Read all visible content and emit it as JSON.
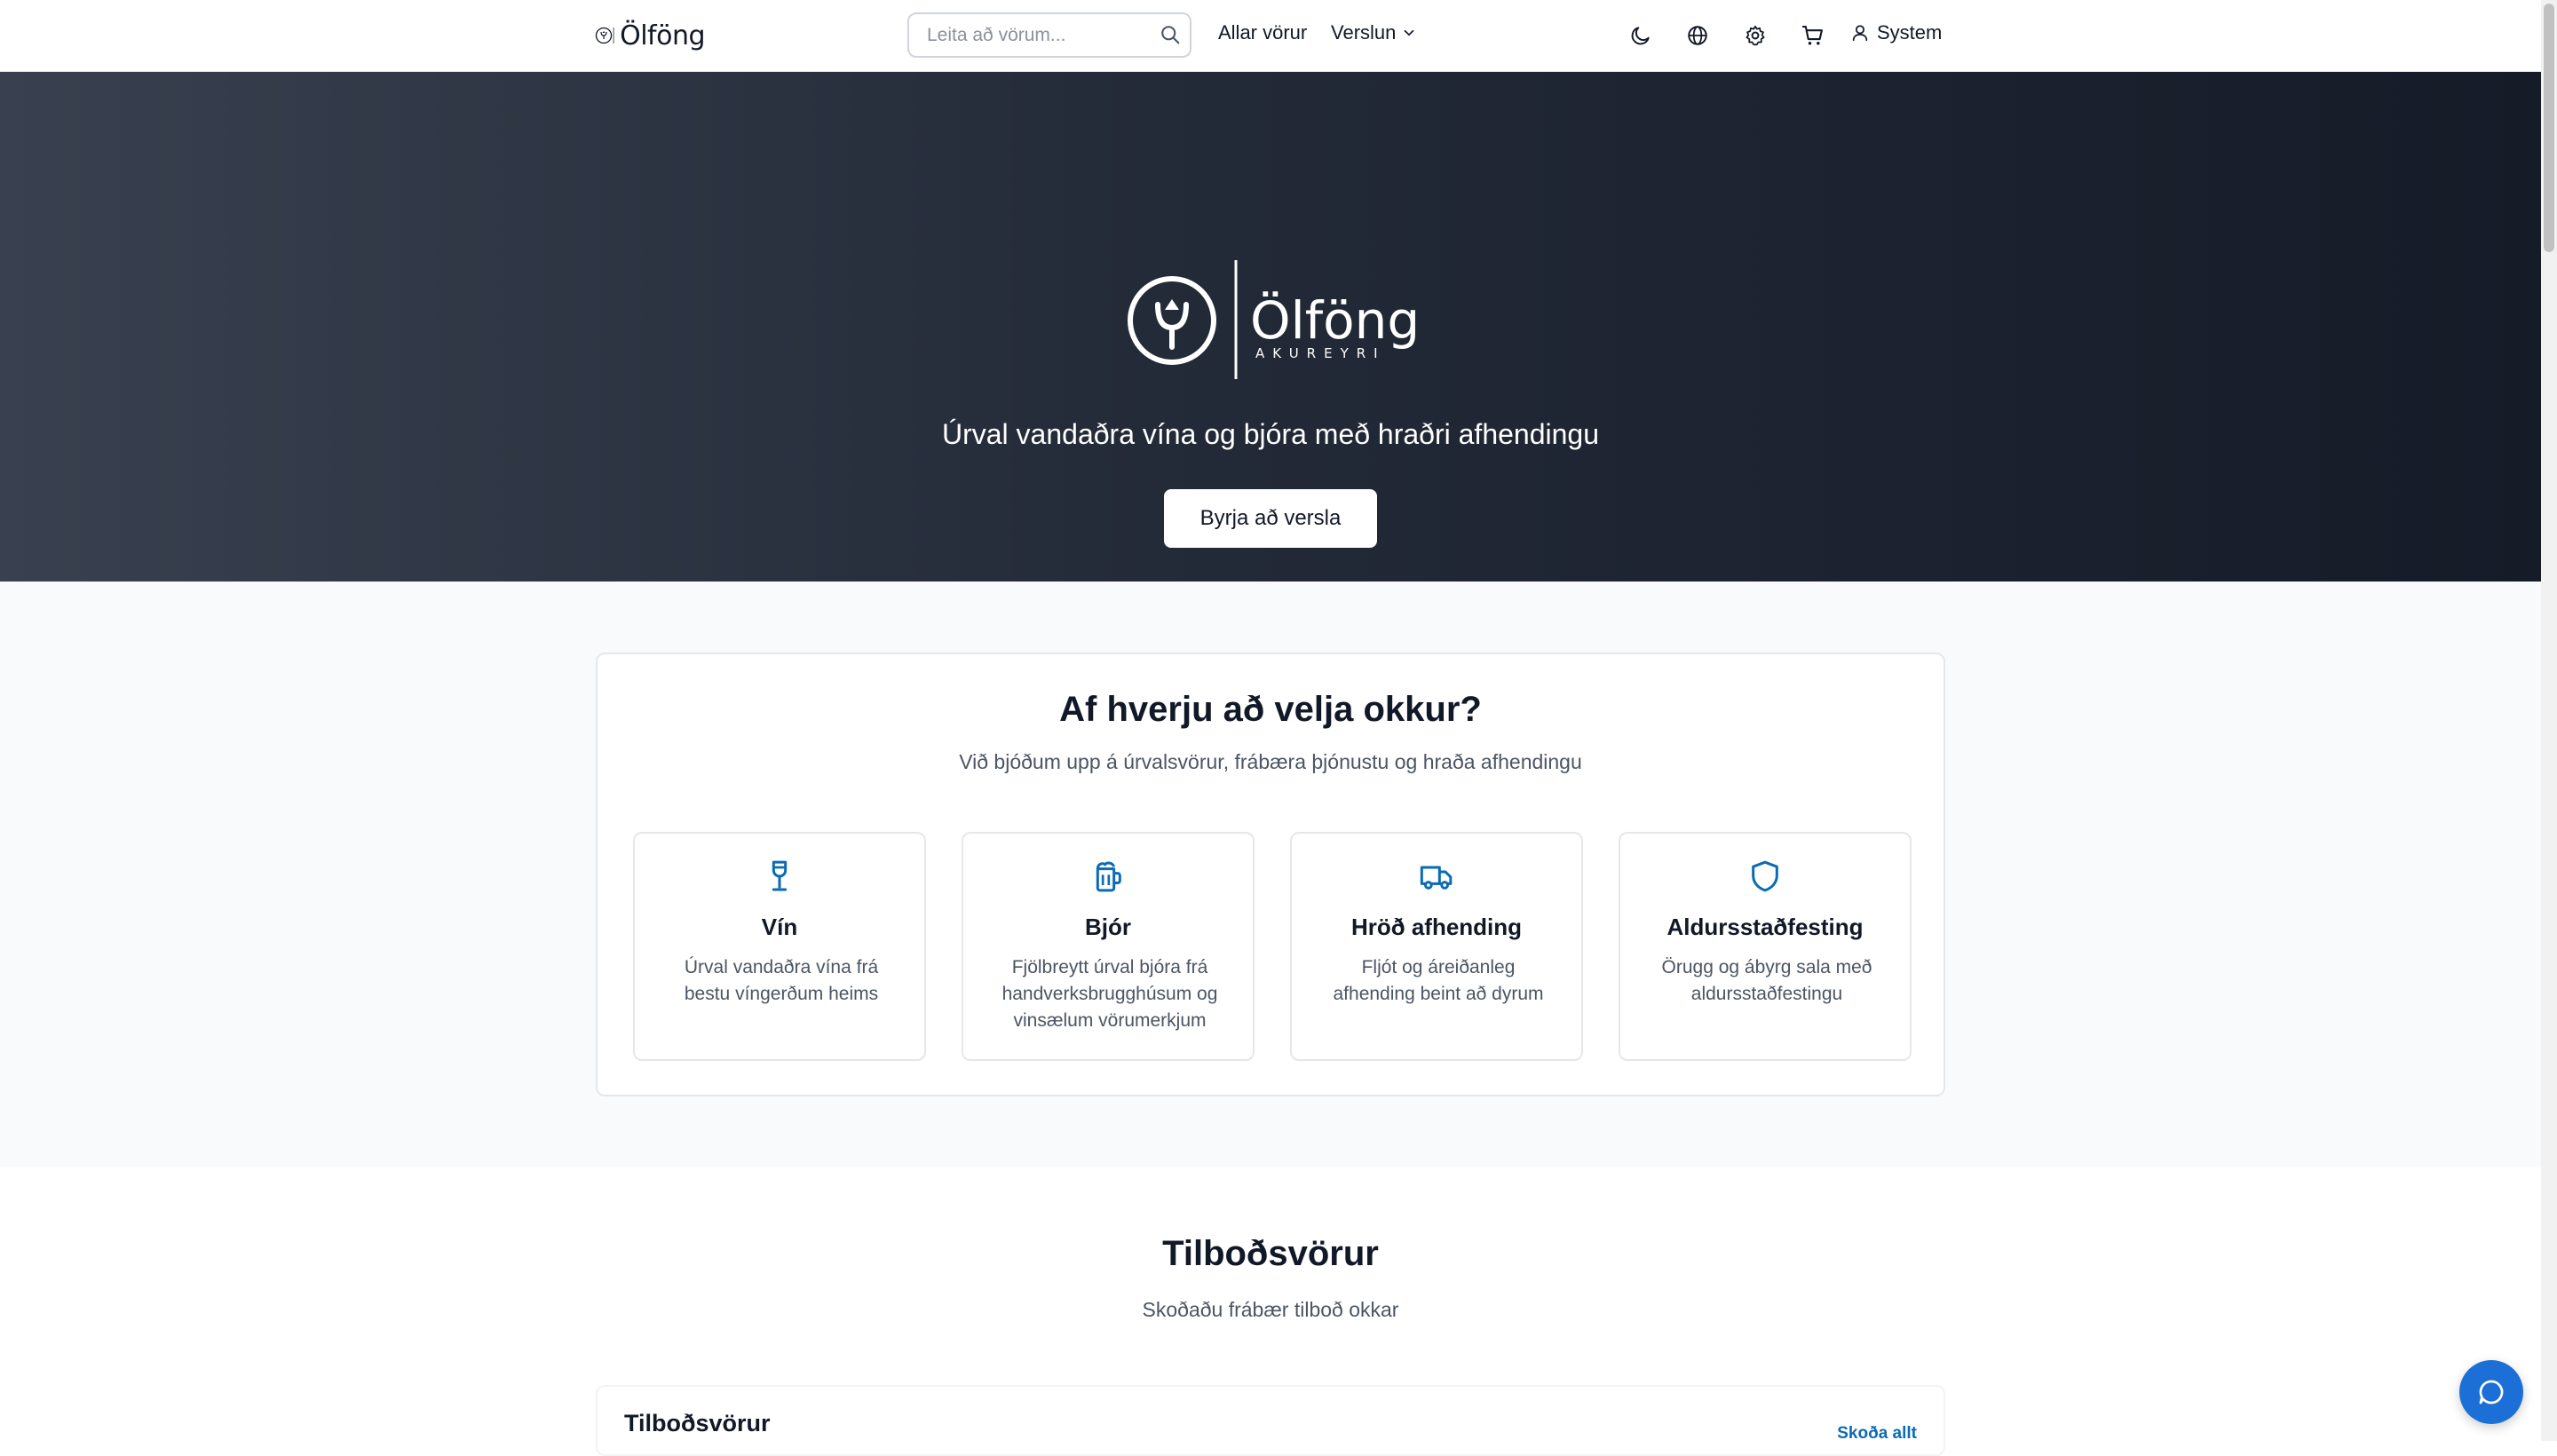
{
  "header": {
    "brand": {
      "name": "Ölföng"
    },
    "search": {
      "placeholder": "Leita að vörum..."
    },
    "nav": {
      "all_products": "Allar vörur",
      "shop": "Verslun"
    },
    "icons": [
      "moon-icon",
      "globe-icon",
      "gear-icon",
      "cart-icon"
    ],
    "user_label": "System"
  },
  "hero": {
    "brand": "Ölföng",
    "brand_sub": "AKUREYRI",
    "tagline": "Úrval vandaðra vína og bjóra með hraðri afhendingu",
    "cta_label": "Byrja að versla"
  },
  "why": {
    "title": "Af hverju að velja okkur?",
    "subtitle": "Við bjóðum upp á úrvalsvörur, frábæra þjónustu og hraða afhendingu",
    "features": [
      {
        "icon": "wine-glass-icon",
        "title": "Vín",
        "description": "Úrval vandaðra vína frá bestu víngerðum heims"
      },
      {
        "icon": "beer-mug-icon",
        "title": "Bjór",
        "description": "Fjölbreytt úrval bjóra frá handverksbrugghúsum og vinsælum vörumerkjum"
      },
      {
        "icon": "truck-icon",
        "title": "Hröð afhending",
        "description": "Fljót og áreiðanleg afhending beint að dyrum"
      },
      {
        "icon": "shield-icon",
        "title": "Aldursstaðfesting",
        "description": "Örugg og ábyrg sala með aldursstaðfestingu"
      }
    ]
  },
  "offers": {
    "title": "Tilboðsvörur",
    "subtitle": "Skoðaðu frábær tilboð okkar",
    "panel_title": "Tilboðsvörur",
    "view_all": "Skoða allt"
  },
  "colors": {
    "accent": "#0b6bb3",
    "hero_dark": "#161b28",
    "chat_button": "#1d6fd8"
  }
}
